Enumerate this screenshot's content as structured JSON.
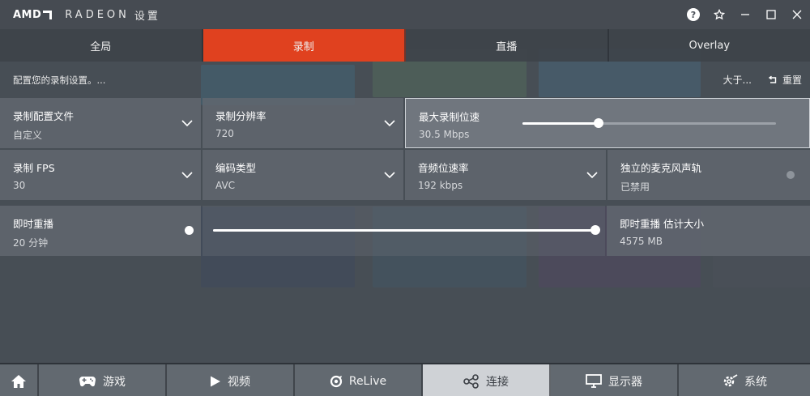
{
  "app": {
    "brand": "AMD",
    "product": "RADEON",
    "settings_label": "设置"
  },
  "tabs": [
    {
      "label": "全局",
      "active": false
    },
    {
      "label": "录制",
      "active": true
    },
    {
      "label": "直播",
      "active": false
    },
    {
      "label": "Overlay",
      "active": false
    }
  ],
  "subheader": {
    "description": "配置您的录制设置。...",
    "about_label": "大于...",
    "reset_label": "重置"
  },
  "settings": {
    "record_profile": {
      "label": "录制配置文件",
      "value": "自定义"
    },
    "record_resolution": {
      "label": "录制分辨率",
      "value": "720"
    },
    "max_bitrate": {
      "label": "最大录制位速",
      "value": "30.5 Mbps",
      "slider_fraction": 0.3
    },
    "record_fps": {
      "label": "录制 FPS",
      "value": "30"
    },
    "encoding_type": {
      "label": "编码类型",
      "value": "AVC"
    },
    "audio_bitrate": {
      "label": "音频位速率",
      "value": "192 kbps"
    },
    "separate_mic_track": {
      "label": "独立的麦克风声轨",
      "value": "已禁用",
      "enabled": false
    },
    "instant_replay": {
      "label": "即时重播",
      "value": "20 分钟",
      "enabled": true,
      "slider_fraction": 1.0
    },
    "instant_replay_size": {
      "label": "即时重播 估计大小",
      "value": "4575 MB"
    }
  },
  "bottom_nav": [
    {
      "label": "",
      "icon": "home-icon",
      "active": false
    },
    {
      "label": "游戏",
      "icon": "gamepad-icon",
      "active": false
    },
    {
      "label": "视频",
      "icon": "play-icon",
      "active": false
    },
    {
      "label": "ReLive",
      "icon": "relive-icon",
      "active": false
    },
    {
      "label": "连接",
      "icon": "connect-icon",
      "active": true
    },
    {
      "label": "显示器",
      "icon": "monitor-icon",
      "active": false
    },
    {
      "label": "系统",
      "icon": "system-gear-icon",
      "active": false
    }
  ],
  "colors": {
    "accent": "#e0411f",
    "card": "#626870",
    "background": "#4a5058"
  }
}
